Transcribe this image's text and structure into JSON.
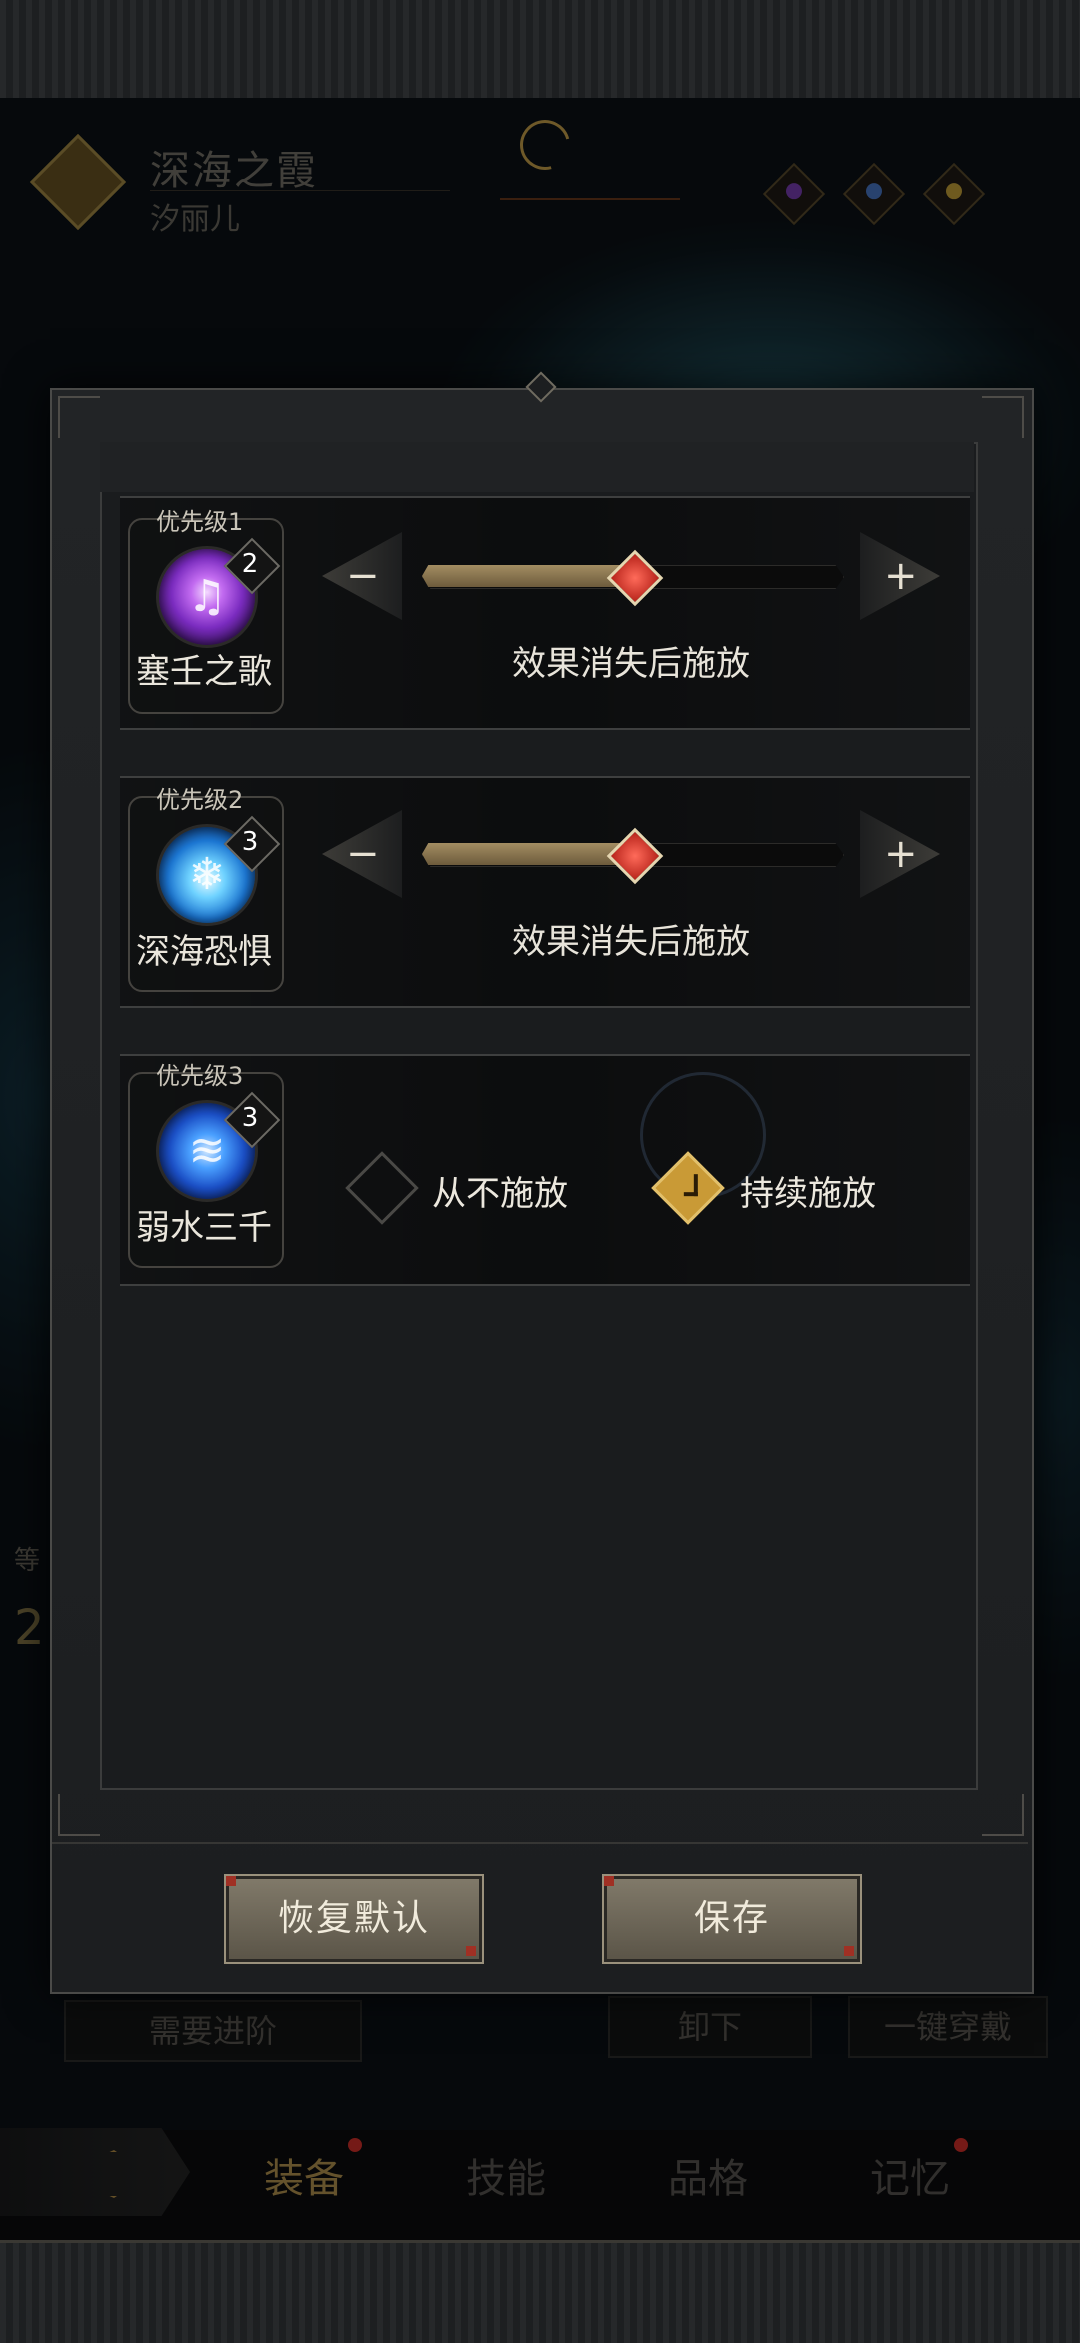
{
  "header": {
    "hero_name": "深海之霞",
    "hero_subname": "汐丽儿"
  },
  "background": {
    "side_stat_label": "等",
    "side_stat_value": "2",
    "buttons": {
      "advance": "需要进阶",
      "unequip": "卸下",
      "equip_all": "一键穿戴"
    }
  },
  "bottom_nav": {
    "items": [
      {
        "label": "装备",
        "active": true,
        "badge": true
      },
      {
        "label": "技能",
        "active": false,
        "badge": false
      },
      {
        "label": "品格",
        "active": false,
        "badge": false
      },
      {
        "label": "记忆",
        "active": false,
        "badge": true
      }
    ]
  },
  "dialog": {
    "skills": [
      {
        "priority": "优先级1",
        "name": "塞壬之歌",
        "level": "2",
        "icon": "music-note-icon",
        "control": "slider",
        "slider_value": 0.5,
        "caption": "效果消失后施放"
      },
      {
        "priority": "优先级2",
        "name": "深海恐惧",
        "level": "3",
        "icon": "ice-crystal-icon",
        "control": "slider",
        "slider_value": 0.5,
        "caption": "效果消失后施放"
      },
      {
        "priority": "优先级3",
        "name": "弱水三千",
        "level": "3",
        "icon": "water-swirl-icon",
        "control": "choice",
        "options": [
          {
            "label": "从不施放",
            "checked": false
          },
          {
            "label": "持续施放",
            "checked": true
          }
        ]
      }
    ],
    "minus_symbol": "−",
    "plus_symbol": "+",
    "reset_button": "恢复默认",
    "save_button": "保存"
  },
  "colors": {
    "accent_gold": "#c99a36",
    "slider_knob": "#d8392b",
    "badge_red": "#d5312a"
  }
}
